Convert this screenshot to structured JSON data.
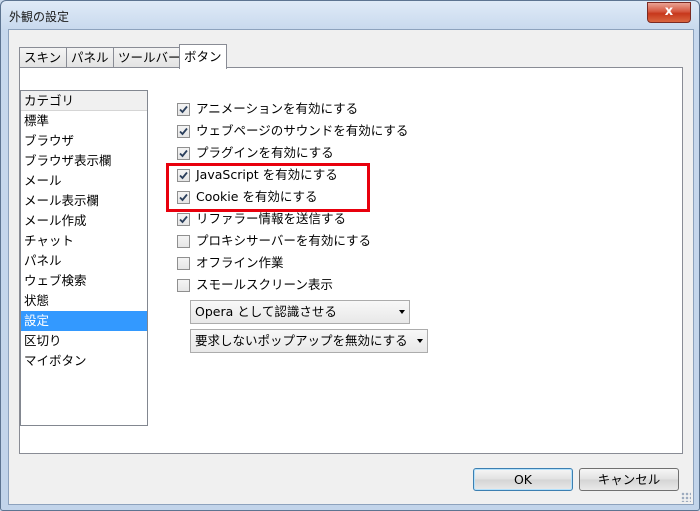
{
  "window": {
    "title": "外観の設定",
    "close_glyph": "x"
  },
  "tabs": [
    {
      "label": "スキン",
      "active": false
    },
    {
      "label": "パネル",
      "active": false
    },
    {
      "label": "ツールバー",
      "active": false
    },
    {
      "label": "ボタン",
      "active": true
    }
  ],
  "categories": {
    "header": "カテゴリ",
    "items": [
      "標準",
      "ブラウザ",
      "ブラウザ表示欄",
      "メール",
      "メール表示欄",
      "メール作成",
      "チャット",
      "パネル",
      "ウェブ検索",
      "状態",
      "設定",
      "区切り",
      "マイボタン"
    ],
    "selected": "設定"
  },
  "options": [
    {
      "label": "アニメーションを有効にする",
      "checked": true
    },
    {
      "label": "ウェブページのサウンドを有効にする",
      "checked": true
    },
    {
      "label": "プラグインを有効にする",
      "checked": true
    },
    {
      "label": "JavaScript を有効にする",
      "checked": true
    },
    {
      "label": "Cookie を有効にする",
      "checked": true
    },
    {
      "label": "リファラー情報を送信する",
      "checked": true
    },
    {
      "label": "プロキシサーバーを有効にする",
      "checked": false
    },
    {
      "label": "オフライン作業",
      "checked": false
    },
    {
      "label": "スモールスクリーン表示",
      "checked": false
    }
  ],
  "dropdowns": [
    {
      "value": "Opera として認識させる"
    },
    {
      "value": "要求しないポップアップを無効にする"
    }
  ],
  "buttons": {
    "ok": "OK",
    "cancel": "キャンセル"
  },
  "colors": {
    "selection": "#3399ff",
    "highlight_box": "#e8000d"
  }
}
